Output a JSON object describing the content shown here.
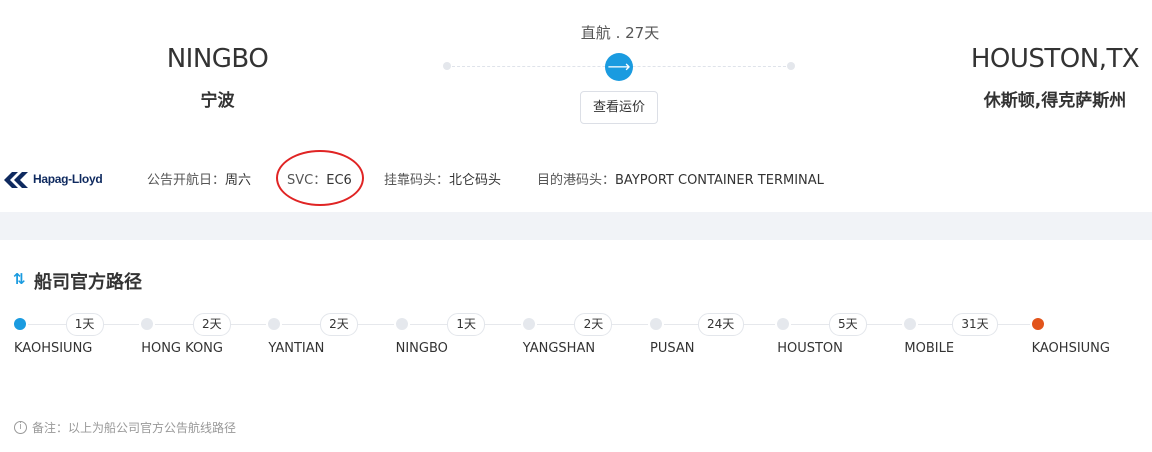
{
  "header": {
    "origin": {
      "en": "NINGBO",
      "cn": "宁波"
    },
    "destination": {
      "en": "HOUSTON,TX",
      "cn": "休斯顿,得克萨斯州"
    },
    "route_info": "直航 . 27天",
    "arrow_glyph": "⟶",
    "price_button": "查看运价"
  },
  "info": {
    "carrier_logo": "Hapag-Lloyd",
    "sailing_day_label": "公告开航日：",
    "sailing_day": "周六",
    "svc_label": "SVC：",
    "svc": "EC6",
    "berth_label": "挂靠码头：",
    "berth": "北仑码头",
    "dest_terminal_label": "目的港码头：",
    "dest_terminal": "BAYPORT CONTAINER TERMINAL"
  },
  "route": {
    "title": "船司官方路径",
    "icon_glyph": "⇅",
    "stops": [
      {
        "name": "KAOHSIUNG",
        "days": "1天"
      },
      {
        "name": "HONG KONG",
        "days": "2天"
      },
      {
        "name": "YANTIAN",
        "days": "2天"
      },
      {
        "name": "NINGBO",
        "days": "1天"
      },
      {
        "name": "YANGSHAN",
        "days": "2天"
      },
      {
        "name": "PUSAN",
        "days": "24天"
      },
      {
        "name": "HOUSTON",
        "days": "5天"
      },
      {
        "name": "MOBILE",
        "days": "31天"
      },
      {
        "name": "KAOHSIUNG",
        "days": ""
      }
    ]
  },
  "note": {
    "icon_glyph": "i",
    "text": "备注：以上为船公司官方公告航线路径"
  },
  "colors": {
    "accent": "#1a9be0",
    "end_stop": "#e2541b",
    "annotation": "#e02424"
  }
}
